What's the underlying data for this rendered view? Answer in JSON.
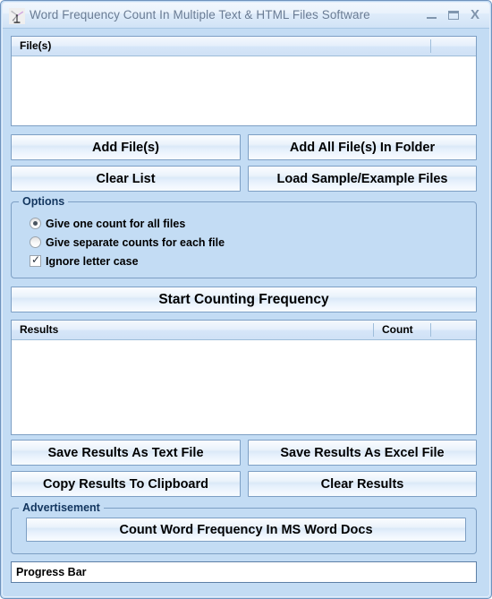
{
  "window": {
    "title": "Word Frequency Count In Multiple Text & HTML Files Software",
    "icon": "windmill-icon",
    "controls": {
      "minimize": "minimize-icon",
      "maximize": "maximize-icon",
      "close": "X"
    },
    "colors": {
      "background": "#c3dcf4",
      "border": "#6f93bd",
      "titlebar_text": "#6a7c94",
      "button_border": "#7d9fc4",
      "group_title": "#12355e"
    }
  },
  "file_list": {
    "columns": [
      "File(s)",
      ""
    ],
    "rows": []
  },
  "file_buttons": [
    {
      "label": "Add File(s)"
    },
    {
      "label": "Add All File(s) In Folder"
    },
    {
      "label": "Clear List"
    },
    {
      "label": "Load Sample/Example Files"
    }
  ],
  "options": {
    "title": "Options",
    "items": [
      {
        "type": "radio",
        "label": "Give one count for all files",
        "checked": true
      },
      {
        "type": "radio",
        "label": "Give separate counts for each file",
        "checked": false
      },
      {
        "type": "checkbox",
        "label": "Ignore letter case",
        "checked": true
      }
    ]
  },
  "start_button": {
    "label": "Start Counting Frequency"
  },
  "results_list": {
    "columns": [
      "Results",
      "Count",
      ""
    ],
    "rows": []
  },
  "results_buttons": [
    {
      "label": "Save Results As Text File"
    },
    {
      "label": "Save Results As Excel File"
    },
    {
      "label": "Copy Results To Clipboard"
    },
    {
      "label": "Clear Results"
    }
  ],
  "advertisement": {
    "title": "Advertisement",
    "button_label": "Count Word Frequency In MS Word Docs"
  },
  "progress": {
    "label": "Progress Bar"
  }
}
